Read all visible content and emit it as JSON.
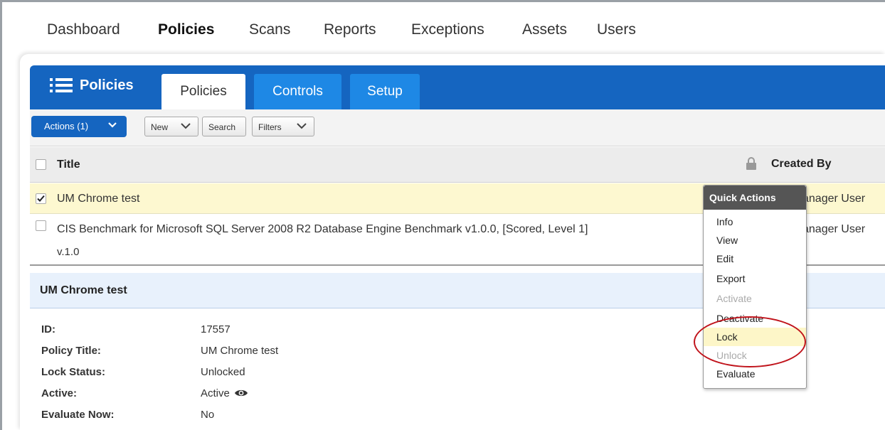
{
  "topnav": {
    "items": [
      {
        "label": "Dashboard",
        "active": false
      },
      {
        "label": "Policies",
        "active": true
      },
      {
        "label": "Scans",
        "active": false
      },
      {
        "label": "Reports",
        "active": false
      },
      {
        "label": "Exceptions",
        "active": false
      },
      {
        "label": "Assets",
        "active": false
      },
      {
        "label": "Users",
        "active": false
      }
    ]
  },
  "module": {
    "title": "Policies",
    "icon": "list-icon",
    "tabs": [
      {
        "label": "Policies",
        "active": true
      },
      {
        "label": "Controls",
        "active": false
      },
      {
        "label": "Setup",
        "active": false
      }
    ]
  },
  "toolbar": {
    "actions_label": "Actions (1)",
    "new_label": "New",
    "search_label": "Search",
    "filters_label": "Filters"
  },
  "table": {
    "columns": {
      "title": "Title",
      "created_by": "Created By"
    },
    "rows": [
      {
        "title": "UM Chrome test",
        "version": "",
        "created_by": "anager User",
        "checked": true
      },
      {
        "title": "CIS Benchmark for Microsoft SQL Server 2008 R2 Database Engine Benchmark v1.0.0, [Scored, Level 1]",
        "version": "v.1.0",
        "created_by": "anager User",
        "checked": false
      }
    ]
  },
  "detail": {
    "title": "UM Chrome test",
    "fields": [
      {
        "label": "ID:",
        "value": "17557"
      },
      {
        "label": "Policy Title:",
        "value": "UM Chrome test"
      },
      {
        "label": "Lock Status:",
        "value": "Unlocked"
      },
      {
        "label": "Active:",
        "value": "Active"
      },
      {
        "label": "Evaluate Now:",
        "value": "No"
      }
    ]
  },
  "quick_actions": {
    "header": "Quick Actions",
    "items": [
      {
        "label": "Info",
        "disabled": false
      },
      {
        "label": "View",
        "disabled": false
      },
      {
        "label": "Edit",
        "disabled": false
      },
      {
        "label": "Export",
        "disabled": false
      },
      {
        "label": "Activate",
        "disabled": true
      },
      {
        "label": "Deactivate",
        "disabled": false
      },
      {
        "label": "Lock",
        "disabled": false,
        "highlighted": true
      },
      {
        "label": "Unlock",
        "disabled": true
      },
      {
        "label": "Evaluate",
        "disabled": false
      }
    ]
  },
  "colors": {
    "primary_blue": "#1565c0",
    "tab_blue": "#1e88e5",
    "selected_row": "#fdf8d0",
    "annotation_red": "#c0131b"
  }
}
